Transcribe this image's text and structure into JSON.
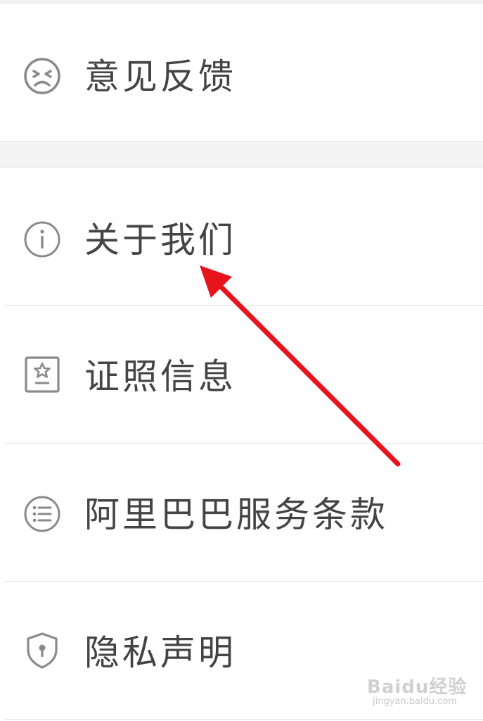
{
  "menu": {
    "items": [
      {
        "label": "意见反馈",
        "icon": "sad-face-icon"
      },
      {
        "label": "关于我们",
        "icon": "info-circle-icon"
      },
      {
        "label": "证照信息",
        "icon": "license-badge-icon"
      },
      {
        "label": "阿里巴巴服务条款",
        "icon": "list-circle-icon"
      },
      {
        "label": "隐私声明",
        "icon": "shield-keyhole-icon"
      }
    ]
  },
  "annotation": {
    "arrow_color": "#e8141c",
    "points_to": "关于我们"
  },
  "watermark": {
    "brand": "Baidu经验",
    "url": "jingyan.baidu.com"
  },
  "colors": {
    "text": "#444444",
    "icon": "#8a8a8a",
    "divider": "#e2e2e2",
    "section_gap": "#f4f4f4",
    "arrow": "#e8141c"
  }
}
